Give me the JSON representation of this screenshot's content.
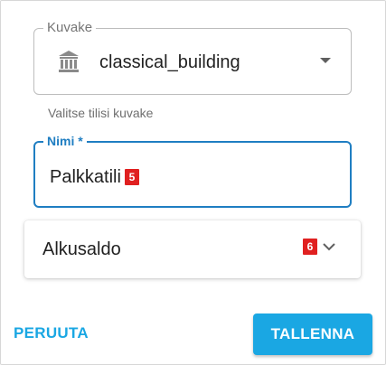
{
  "icon_field": {
    "label": "Kuvake",
    "value": "classical_building",
    "icon": "classical-building-icon",
    "helper": "Valitse tilisi kuvake"
  },
  "name_field": {
    "label": "Nimi *",
    "value": "Palkkatili",
    "badge": "5"
  },
  "panel": {
    "title": "Alkusaldo",
    "badge": "6",
    "icon": "chevron-down-icon"
  },
  "actions": {
    "cancel_label": "PERUUTA",
    "save_label": "TALLENNA"
  },
  "colors": {
    "accent": "#1aa7e3",
    "focus": "#1f7ec2",
    "badge": "#e02020"
  }
}
